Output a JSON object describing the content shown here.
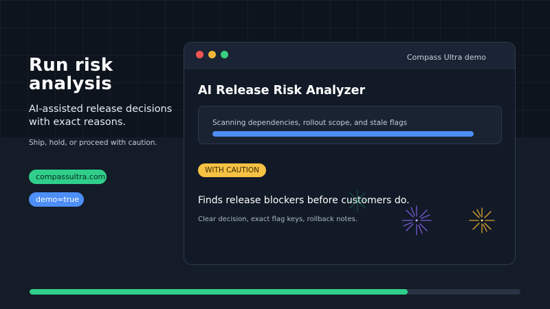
{
  "hero": {
    "title": "Run risk analysis",
    "subtitle": "AI-assisted release decisions with exact reasons.",
    "note": "Ship, hold, or proceed with caution."
  },
  "pills": {
    "domain": "compassultra.com",
    "demo": "demo=true"
  },
  "window": {
    "title": "Compass Ultra demo",
    "app_title": "AI Release Risk Analyzer",
    "scan": {
      "text": "Scanning dependencies, rollout scope, and stale flags",
      "progress_percent": 100
    },
    "decision_badge": "WITH CAUTION",
    "finding_title": "Finds release blockers before customers do.",
    "finding_subtitle": "Clear decision, exact flag keys, rollback notes."
  },
  "bottom_progress": {
    "percent": 77
  },
  "icons": [
    "close-dot-icon",
    "minimize-dot-icon",
    "maximize-dot-icon",
    "sparkle-icon"
  ],
  "colors": {
    "accent_green": "#2fcf8b",
    "accent_blue": "#4d8ef7",
    "caution_yellow": "#f6c244",
    "window_bg": "#121a27",
    "page_bg": "#141c28"
  }
}
